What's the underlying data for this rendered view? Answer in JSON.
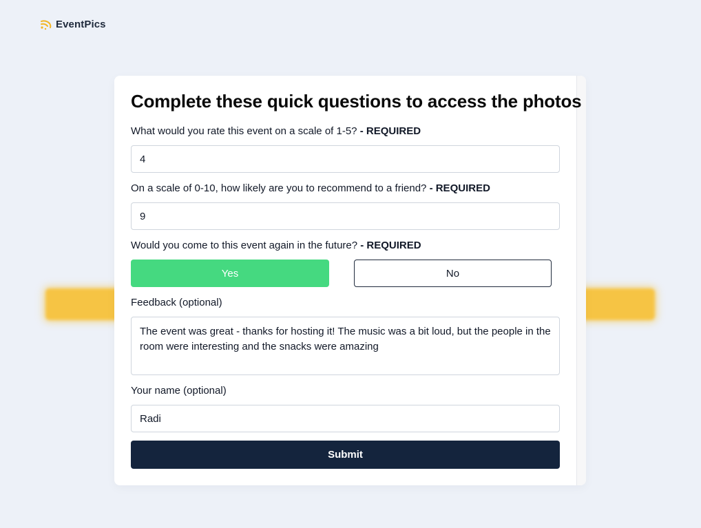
{
  "brand": {
    "name": "EventPics",
    "icon": "sparkle-icon",
    "accent": "#f6c444"
  },
  "form": {
    "title": "Complete these quick questions to access the photos",
    "required_tag": "- REQUIRED",
    "q1": {
      "label": "What would you rate this event on a scale of 1-5?",
      "value": "4"
    },
    "q2": {
      "label": "On a scale of 0-10, how likely are you to recommend to a friend?",
      "value": "9"
    },
    "q3": {
      "label": "Would you come to this event again in the future?",
      "yes_label": "Yes",
      "no_label": "No",
      "selected": "Yes"
    },
    "feedback": {
      "label": "Feedback (optional)",
      "value": "The event was great - thanks for hosting it! The music was a bit loud, but the people in the room were interesting and the snacks were amazing"
    },
    "name": {
      "label": "Your name (optional)",
      "value": "Radi"
    },
    "submit_label": "Submit"
  },
  "colors": {
    "yes_selected": "#45d980",
    "submit_bg": "#14243d",
    "page_bg": "#edf1f8"
  }
}
